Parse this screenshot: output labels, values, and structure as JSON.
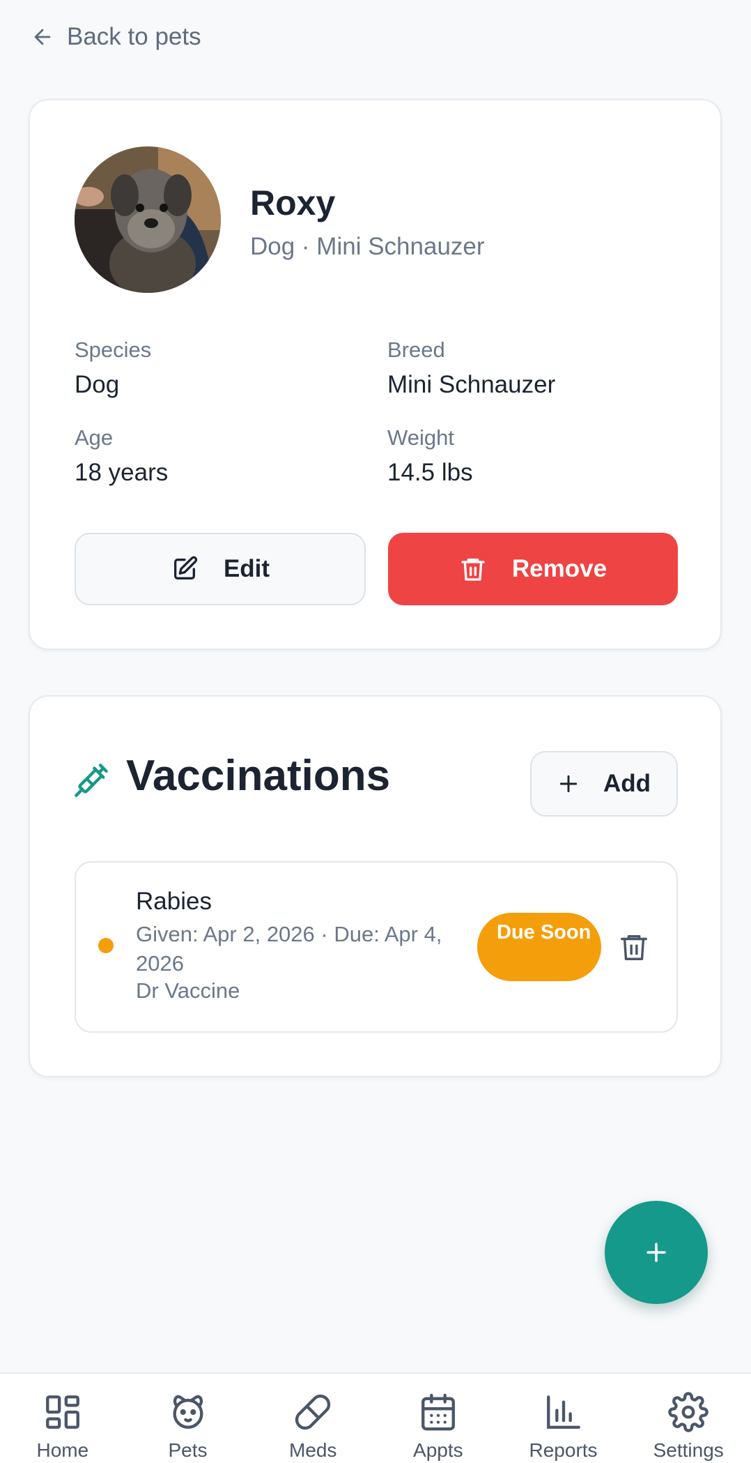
{
  "nav": {
    "back_label": "Back to pets"
  },
  "pet": {
    "name": "Roxy",
    "subtitle": "Dog · Mini Schnauzer",
    "stats": {
      "species": {
        "label": "Species",
        "value": "Dog"
      },
      "breed": {
        "label": "Breed",
        "value": "Mini Schnauzer"
      },
      "age": {
        "label": "Age",
        "value": "18 years"
      },
      "weight": {
        "label": "Weight",
        "value": "14.5 lbs"
      }
    },
    "actions": {
      "edit_label": "Edit",
      "remove_label": "Remove"
    }
  },
  "vaccinations": {
    "title": "Vaccinations",
    "add_label": "Add",
    "items": [
      {
        "name": "Rabies",
        "dates": "Given: Apr 2, 2026 · Due: Apr 4, 2026",
        "vet": "Dr Vaccine",
        "status": "Due Soon",
        "status_color": "#f59e0b"
      }
    ]
  },
  "bottom_nav": [
    {
      "label": "Home",
      "icon": "home-icon"
    },
    {
      "label": "Pets",
      "icon": "paw-icon"
    },
    {
      "label": "Meds",
      "icon": "pill-icon"
    },
    {
      "label": "Appts",
      "icon": "calendar-icon"
    },
    {
      "label": "Reports",
      "icon": "chart-icon"
    },
    {
      "label": "Settings",
      "icon": "gear-icon"
    }
  ],
  "colors": {
    "accent": "#14998a",
    "danger": "#ef4444",
    "warning": "#f59e0b",
    "background": "#f7f9fb"
  }
}
